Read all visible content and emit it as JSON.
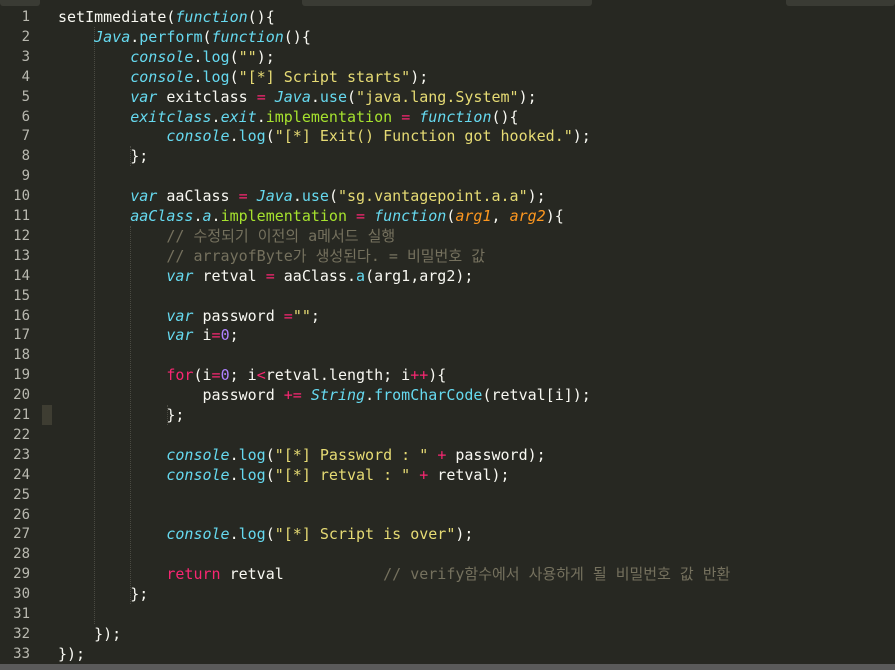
{
  "editor": {
    "language": "JavaScript",
    "theme_colors": {
      "background": "#272822",
      "foreground": "#f8f8f2",
      "keyword": "#f92672",
      "storage": "#66d9ef",
      "string": "#e6db74",
      "number": "#ae81ff",
      "parameter": "#fd971f",
      "comment": "#75715e",
      "property": "#a6e22e",
      "line_number": "#b9b9b0"
    },
    "active_line": 21,
    "lines": [
      {
        "n": "1",
        "tokens": [
          [
            "plain",
            "setImmediate"
          ],
          [
            "plain",
            "("
          ],
          [
            "func",
            "function"
          ],
          [
            "plain",
            "(){"
          ]
        ]
      },
      {
        "n": "2",
        "tokens": [
          [
            "plain",
            "    "
          ],
          [
            "obj",
            "Java"
          ],
          [
            "plain",
            "."
          ],
          [
            "call",
            "perform"
          ],
          [
            "plain",
            "("
          ],
          [
            "func",
            "function"
          ],
          [
            "plain",
            "(){"
          ]
        ]
      },
      {
        "n": "3",
        "tokens": [
          [
            "plain",
            "        "
          ],
          [
            "obj",
            "console"
          ],
          [
            "plain",
            "."
          ],
          [
            "call",
            "log"
          ],
          [
            "plain",
            "("
          ],
          [
            "str",
            "\"\""
          ],
          [
            "plain",
            ");"
          ]
        ]
      },
      {
        "n": "4",
        "tokens": [
          [
            "plain",
            "        "
          ],
          [
            "obj",
            "console"
          ],
          [
            "plain",
            "."
          ],
          [
            "call",
            "log"
          ],
          [
            "plain",
            "("
          ],
          [
            "str",
            "\"[*] Script starts\""
          ],
          [
            "plain",
            ");"
          ]
        ]
      },
      {
        "n": "5",
        "tokens": [
          [
            "plain",
            "        "
          ],
          [
            "store",
            "var"
          ],
          [
            "plain",
            " exitclass "
          ],
          [
            "op",
            "="
          ],
          [
            "plain",
            " "
          ],
          [
            "obj",
            "Java"
          ],
          [
            "plain",
            "."
          ],
          [
            "call",
            "use"
          ],
          [
            "plain",
            "("
          ],
          [
            "str",
            "\"java.lang.System\""
          ],
          [
            "plain",
            ");"
          ]
        ]
      },
      {
        "n": "6",
        "tokens": [
          [
            "plain",
            "        "
          ],
          [
            "obj",
            "exitclass"
          ],
          [
            "plain",
            "."
          ],
          [
            "obj",
            "exit"
          ],
          [
            "plain",
            "."
          ],
          [
            "prop",
            "implementation"
          ],
          [
            "plain",
            " "
          ],
          [
            "op",
            "="
          ],
          [
            "plain",
            " "
          ],
          [
            "func",
            "function"
          ],
          [
            "plain",
            "(){"
          ]
        ]
      },
      {
        "n": "7",
        "tokens": [
          [
            "plain",
            "            "
          ],
          [
            "obj",
            "console"
          ],
          [
            "plain",
            "."
          ],
          [
            "call",
            "log"
          ],
          [
            "plain",
            "("
          ],
          [
            "str",
            "\"[*] Exit() Function got hooked.\""
          ],
          [
            "plain",
            ");"
          ]
        ]
      },
      {
        "n": "8",
        "tokens": [
          [
            "plain",
            "        };"
          ]
        ]
      },
      {
        "n": "9",
        "tokens": [
          [
            "plain",
            ""
          ]
        ]
      },
      {
        "n": "10",
        "tokens": [
          [
            "plain",
            "        "
          ],
          [
            "store",
            "var"
          ],
          [
            "plain",
            " aaClass "
          ],
          [
            "op",
            "="
          ],
          [
            "plain",
            " "
          ],
          [
            "obj",
            "Java"
          ],
          [
            "plain",
            "."
          ],
          [
            "call",
            "use"
          ],
          [
            "plain",
            "("
          ],
          [
            "str",
            "\"sg.vantagepoint.a.a\""
          ],
          [
            "plain",
            ");"
          ]
        ]
      },
      {
        "n": "11",
        "tokens": [
          [
            "plain",
            "        "
          ],
          [
            "obj",
            "aaClass"
          ],
          [
            "plain",
            "."
          ],
          [
            "obj",
            "a"
          ],
          [
            "plain",
            "."
          ],
          [
            "prop",
            "implementation"
          ],
          [
            "plain",
            " "
          ],
          [
            "op",
            "="
          ],
          [
            "plain",
            " "
          ],
          [
            "func",
            "function"
          ],
          [
            "plain",
            "("
          ],
          [
            "param",
            "arg1"
          ],
          [
            "plain",
            ", "
          ],
          [
            "param",
            "arg2"
          ],
          [
            "plain",
            "){"
          ]
        ]
      },
      {
        "n": "12",
        "tokens": [
          [
            "plain",
            "            "
          ],
          [
            "cmt",
            "// 수정되기 이전의 a메서드 실행"
          ]
        ]
      },
      {
        "n": "13",
        "tokens": [
          [
            "plain",
            "            "
          ],
          [
            "cmt",
            "// arrayofByte가 생성된다. = 비밀번호 값"
          ]
        ]
      },
      {
        "n": "14",
        "tokens": [
          [
            "plain",
            "            "
          ],
          [
            "store",
            "var"
          ],
          [
            "plain",
            " retval "
          ],
          [
            "op",
            "="
          ],
          [
            "plain",
            " aaClass."
          ],
          [
            "call",
            "a"
          ],
          [
            "plain",
            "(arg1,arg2);"
          ]
        ]
      },
      {
        "n": "15",
        "tokens": [
          [
            "plain",
            ""
          ]
        ]
      },
      {
        "n": "16",
        "tokens": [
          [
            "plain",
            "            "
          ],
          [
            "store",
            "var"
          ],
          [
            "plain",
            " password "
          ],
          [
            "op",
            "="
          ],
          [
            "str",
            "\"\""
          ],
          [
            "plain",
            ";"
          ]
        ]
      },
      {
        "n": "17",
        "tokens": [
          [
            "plain",
            "            "
          ],
          [
            "store",
            "var"
          ],
          [
            "plain",
            " i"
          ],
          [
            "op",
            "="
          ],
          [
            "num",
            "0"
          ],
          [
            "plain",
            ";"
          ]
        ]
      },
      {
        "n": "18",
        "tokens": [
          [
            "plain",
            ""
          ]
        ]
      },
      {
        "n": "19",
        "tokens": [
          [
            "plain",
            "            "
          ],
          [
            "kw",
            "for"
          ],
          [
            "plain",
            "(i"
          ],
          [
            "op",
            "="
          ],
          [
            "num",
            "0"
          ],
          [
            "plain",
            "; i"
          ],
          [
            "op",
            "<"
          ],
          [
            "plain",
            "retval.length; i"
          ],
          [
            "op",
            "++"
          ],
          [
            "plain",
            "){"
          ]
        ]
      },
      {
        "n": "20",
        "tokens": [
          [
            "plain",
            "                password "
          ],
          [
            "op",
            "+="
          ],
          [
            "plain",
            " "
          ],
          [
            "obj",
            "String"
          ],
          [
            "plain",
            "."
          ],
          [
            "call",
            "fromCharCode"
          ],
          [
            "plain",
            "(retval[i]);"
          ]
        ]
      },
      {
        "n": "21",
        "tokens": [
          [
            "plain",
            "            };"
          ]
        ]
      },
      {
        "n": "22",
        "tokens": [
          [
            "plain",
            ""
          ]
        ]
      },
      {
        "n": "23",
        "tokens": [
          [
            "plain",
            "            "
          ],
          [
            "obj",
            "console"
          ],
          [
            "plain",
            "."
          ],
          [
            "call",
            "log"
          ],
          [
            "plain",
            "("
          ],
          [
            "str",
            "\"[*] Password : \""
          ],
          [
            "plain",
            " "
          ],
          [
            "op",
            "+"
          ],
          [
            "plain",
            " password);"
          ]
        ]
      },
      {
        "n": "24",
        "tokens": [
          [
            "plain",
            "            "
          ],
          [
            "obj",
            "console"
          ],
          [
            "plain",
            "."
          ],
          [
            "call",
            "log"
          ],
          [
            "plain",
            "("
          ],
          [
            "str",
            "\"[*] retval : \""
          ],
          [
            "plain",
            " "
          ],
          [
            "op",
            "+"
          ],
          [
            "plain",
            " retval);"
          ]
        ]
      },
      {
        "n": "25",
        "tokens": [
          [
            "plain",
            ""
          ]
        ]
      },
      {
        "n": "26",
        "tokens": [
          [
            "plain",
            ""
          ]
        ]
      },
      {
        "n": "27",
        "tokens": [
          [
            "plain",
            "            "
          ],
          [
            "obj",
            "console"
          ],
          [
            "plain",
            "."
          ],
          [
            "call",
            "log"
          ],
          [
            "plain",
            "("
          ],
          [
            "str",
            "\"[*] Script is over\""
          ],
          [
            "plain",
            ");"
          ]
        ]
      },
      {
        "n": "28",
        "tokens": [
          [
            "plain",
            ""
          ]
        ]
      },
      {
        "n": "29",
        "tokens": [
          [
            "plain",
            "            "
          ],
          [
            "kw",
            "return"
          ],
          [
            "plain",
            " retval           "
          ],
          [
            "cmt",
            "// verify함수에서 사용하게 될 비밀번호 값 반환"
          ]
        ]
      },
      {
        "n": "30",
        "tokens": [
          [
            "plain",
            "        };"
          ]
        ]
      },
      {
        "n": "31",
        "tokens": [
          [
            "plain",
            ""
          ]
        ]
      },
      {
        "n": "32",
        "tokens": [
          [
            "plain",
            "    });"
          ]
        ]
      },
      {
        "n": "33",
        "tokens": [
          [
            "plain",
            "});"
          ]
        ]
      }
    ]
  }
}
